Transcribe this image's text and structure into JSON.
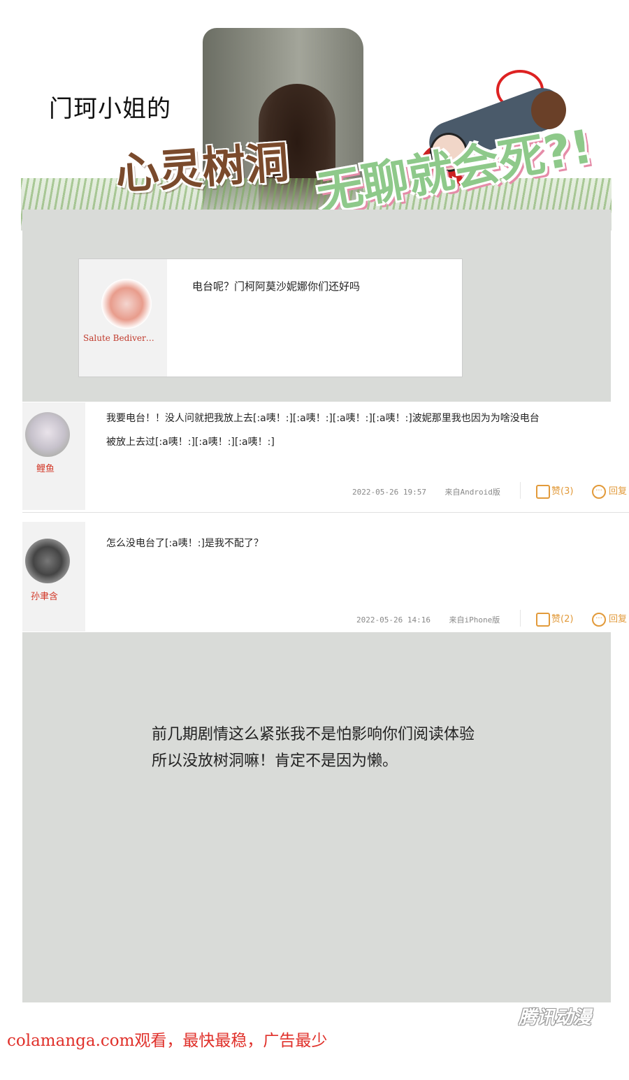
{
  "header": {
    "title_small": "门珂小姐的",
    "title_big": "心灵树洞",
    "slogan": "无聊就会死?!"
  },
  "quote": {
    "username": "Salute Bediver…",
    "text": "电台呢？门柯阿莫沙妮娜你们还好吗"
  },
  "comments": [
    {
      "username": "鲤鱼",
      "text_line1": "我要电台！！没人问就把我放上去[:a咦！:][:a咦！:][:a咦！:][:a咦！:]波妮那里我也因为为啥没电台",
      "text_line2": "被放上去过[:a咦！:][:a咦！:][:a咦！:]",
      "date": "2022-05-26 19:57",
      "source": "来自Android版",
      "like_label": "赞",
      "like_count": "(3)",
      "reply_label": "回复"
    },
    {
      "username": "孙聿含",
      "text_line1": "怎么没电台了[:a咦！:]是我不配了？",
      "date": "2022-05-26 14:16",
      "source": "来自iPhone版",
      "like_label": "赞",
      "like_count": "(2)",
      "reply_label": "回复"
    }
  ],
  "note": {
    "line1": "前几期剧情这么紧张我不是怕影响你们阅读体验",
    "line2": "所以没放树洞嘛！肯定不是因为懒。"
  },
  "watermark": "腾讯动漫",
  "footer": "colamanga.com观看，最快最稳，广告最少",
  "colors": {
    "panel_gray": "#d9dbd8",
    "username_red": "#d23a2a",
    "action_orange": "#e29a3a",
    "footer_red": "#e0302a"
  }
}
